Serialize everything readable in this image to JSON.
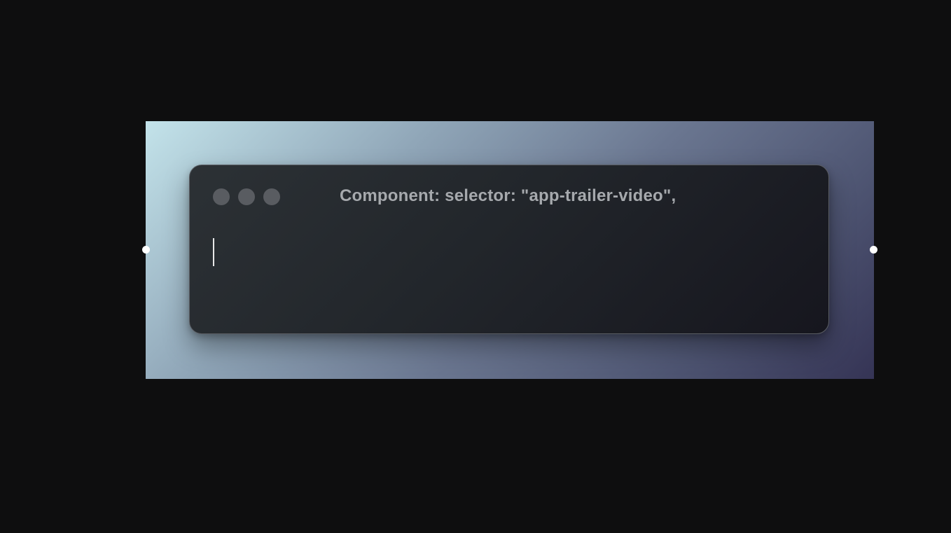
{
  "canvas": {
    "background": "#0e0e0f",
    "gradient_colors": [
      "#c3e3ea",
      "#8fa5b7",
      "#6a7690",
      "#4f5673",
      "#353455"
    ]
  },
  "window": {
    "title": "Component: selector: \"app-trailer-video\",",
    "traffic_lights": [
      "close-dot",
      "minimize-dot",
      "maximize-dot"
    ],
    "editor": {
      "value": ""
    }
  }
}
